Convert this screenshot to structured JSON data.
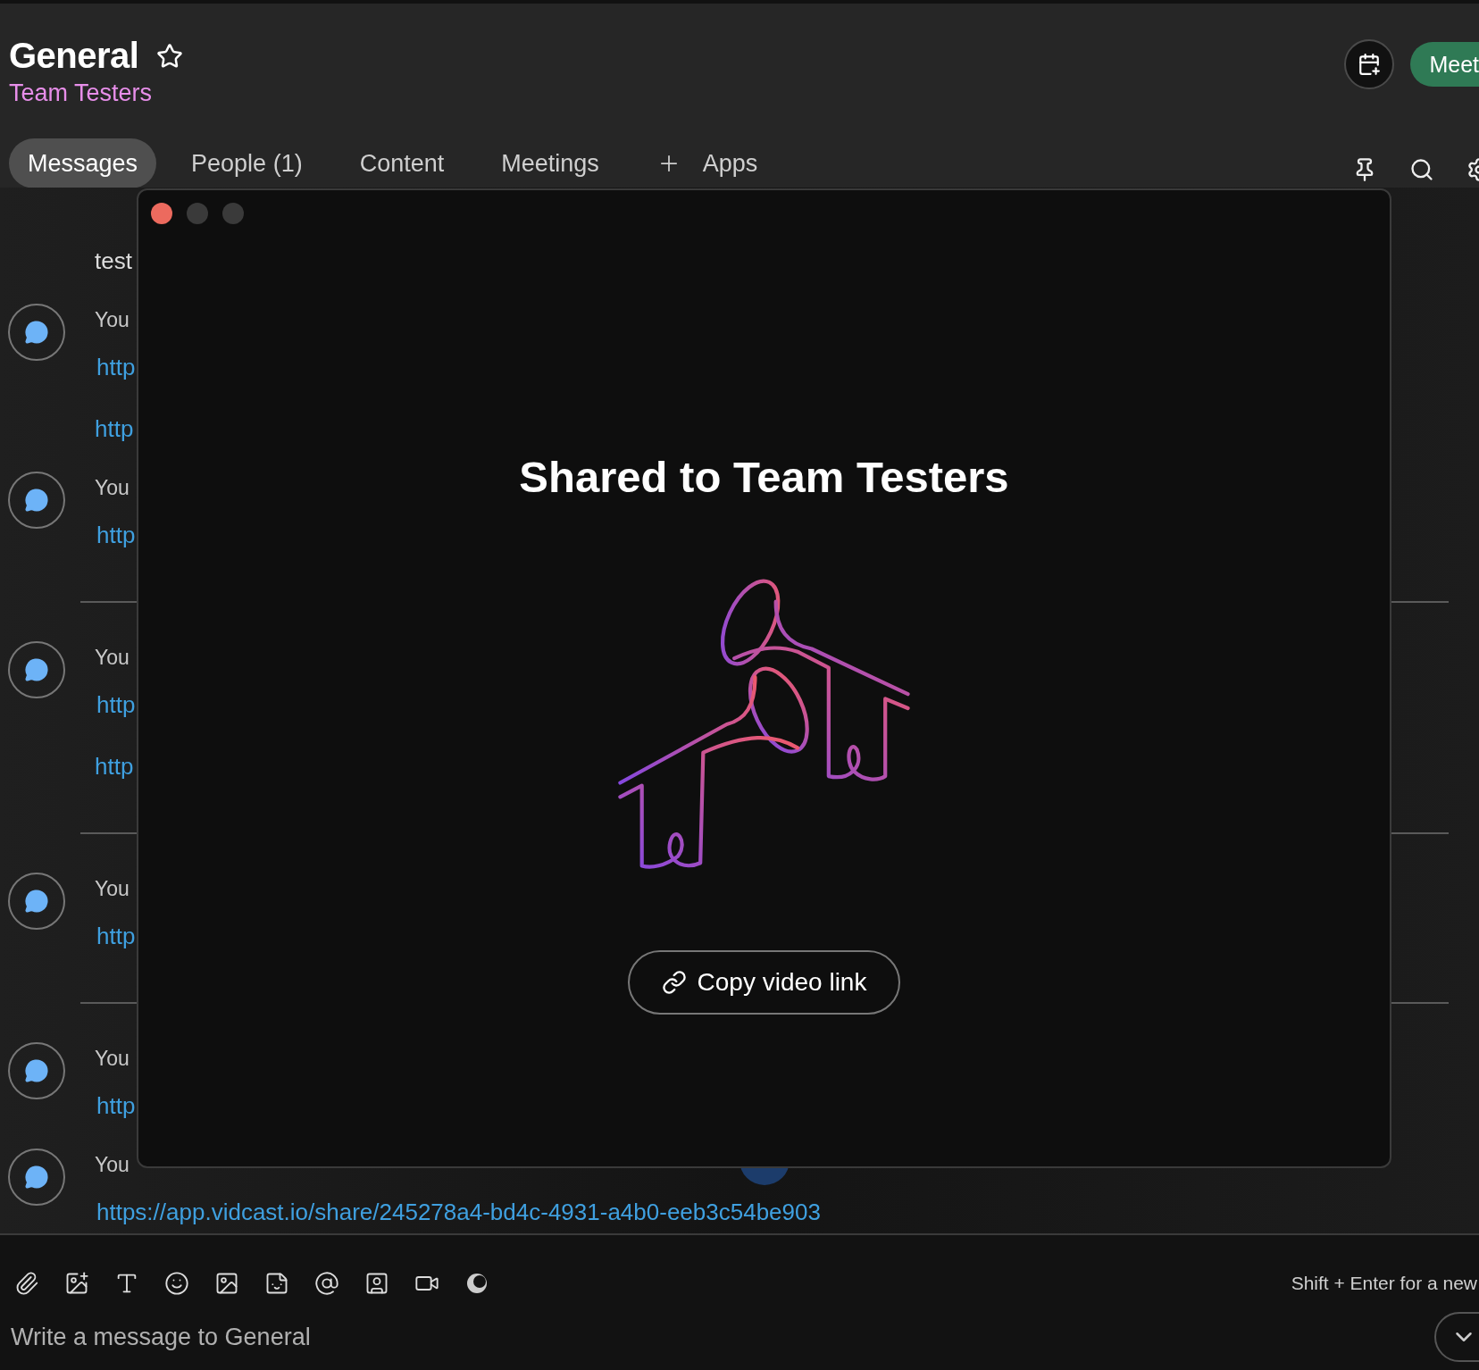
{
  "header": {
    "title": "General",
    "favorite": false,
    "subtitle": "Team Testers",
    "meet_label": "Meet"
  },
  "tabs": [
    {
      "label": "Messages",
      "selected": true,
      "kind": "plain"
    },
    {
      "label": "People (1)",
      "selected": false,
      "kind": "plain"
    },
    {
      "label": "Content",
      "selected": false,
      "kind": "plain"
    },
    {
      "label": "Meetings",
      "selected": false,
      "kind": "plain"
    },
    {
      "label": "Apps",
      "selected": false,
      "kind": "add"
    }
  ],
  "messages": [
    {
      "kind": "text",
      "text": "test"
    },
    {
      "kind": "post",
      "author": "You",
      "lines": [
        "http",
        "http"
      ]
    },
    {
      "kind": "post",
      "author": "You",
      "lines": [
        "http"
      ]
    },
    {
      "kind": "divider"
    },
    {
      "kind": "post",
      "author": "You",
      "lines": [
        "http",
        "http"
      ]
    },
    {
      "kind": "divider"
    },
    {
      "kind": "post",
      "author": "You",
      "lines": [
        "http"
      ]
    },
    {
      "kind": "divider"
    },
    {
      "kind": "post",
      "author": "You",
      "lines": [
        "http"
      ]
    },
    {
      "kind": "post",
      "author": "You",
      "lines": [
        "https://app.vidcast.io/share/245278a4-bd4c-4931-a4b0-eeb3c54be903"
      ]
    }
  ],
  "modal": {
    "title": "Shared to Team Testers",
    "button": "Copy video link"
  },
  "composer": {
    "hint": "Shift + Enter for a new",
    "placeholder": "Write a message to General"
  }
}
